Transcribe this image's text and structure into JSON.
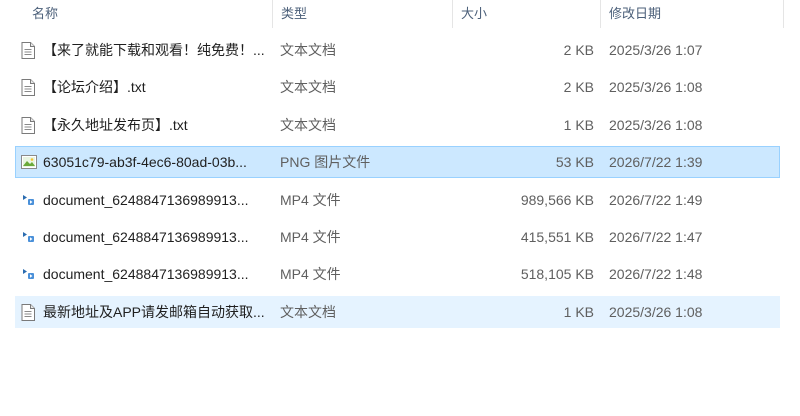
{
  "columns": {
    "name": "名称",
    "type": "类型",
    "size": "大小",
    "modified": "修改日期"
  },
  "colors": {
    "selected_bg": "#cce8ff",
    "hover_bg": "#e5f3ff",
    "header_text": "#4c607a"
  },
  "files": [
    {
      "name": "【来了就能下载和观看！纯免费！...",
      "type": "文本文档",
      "size": "2 KB",
      "modified": "2025/3/26 1:07",
      "icon": "text-file-icon",
      "state": "normal"
    },
    {
      "name": "【论坛介绍】.txt",
      "type": "文本文档",
      "size": "2 KB",
      "modified": "2025/3/26 1:08",
      "icon": "text-file-icon",
      "state": "normal"
    },
    {
      "name": "【永久地址发布页】.txt",
      "type": "文本文档",
      "size": "1 KB",
      "modified": "2025/3/26 1:08",
      "icon": "text-file-icon",
      "state": "normal"
    },
    {
      "name": "63051c79-ab3f-4ec6-80ad-03b...",
      "type": "PNG 图片文件",
      "size": "53 KB",
      "modified": "2026/7/22 1:39",
      "icon": "image-file-icon",
      "state": "selected"
    },
    {
      "name": "document_6248847136989913...",
      "type": "MP4 文件",
      "size": "989,566 KB",
      "modified": "2026/7/22 1:49",
      "icon": "video-file-icon",
      "state": "normal"
    },
    {
      "name": "document_6248847136989913...",
      "type": "MP4 文件",
      "size": "415,551 KB",
      "modified": "2026/7/22 1:47",
      "icon": "video-file-icon",
      "state": "normal"
    },
    {
      "name": "document_6248847136989913...",
      "type": "MP4 文件",
      "size": "518,105 KB",
      "modified": "2026/7/22 1:48",
      "icon": "video-file-icon",
      "state": "normal"
    },
    {
      "name": "最新地址及APP请发邮箱自动获取...",
      "type": "文本文档",
      "size": "1 KB",
      "modified": "2025/3/26 1:08",
      "icon": "text-file-icon",
      "state": "hover"
    }
  ]
}
